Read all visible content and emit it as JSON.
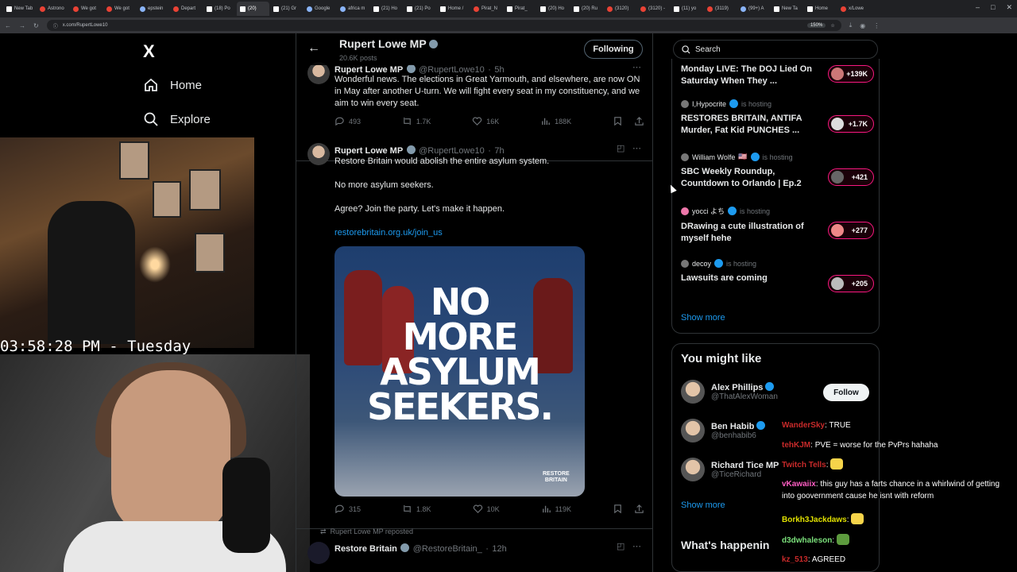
{
  "browser": {
    "tabs": [
      {
        "label": "New Tab",
        "fav": "x"
      },
      {
        "label": "Astrono",
        "fav": "r"
      },
      {
        "label": "We got",
        "fav": "r"
      },
      {
        "label": "We got",
        "fav": "r"
      },
      {
        "label": "epstein",
        "fav": "g"
      },
      {
        "label": "Depart",
        "fav": "r"
      },
      {
        "label": "(18) Po",
        "fav": "x"
      },
      {
        "label": "(20)",
        "fav": "x",
        "active": true
      },
      {
        "label": "(21) Gr",
        "fav": "x"
      },
      {
        "label": "Google",
        "fav": "g"
      },
      {
        "label": "africa m",
        "fav": "g"
      },
      {
        "label": "(21) Ho",
        "fav": "x"
      },
      {
        "label": "(21) Po",
        "fav": "x"
      },
      {
        "label": "Home /",
        "fav": "x"
      },
      {
        "label": "Pirat_N",
        "fav": "r"
      },
      {
        "label": "Pirat_",
        "fav": "x"
      },
      {
        "label": "(20) Ho",
        "fav": "x"
      },
      {
        "label": "(20) Ru",
        "fav": "x"
      },
      {
        "label": "(3120)",
        "fav": "r"
      },
      {
        "label": "(3120) -",
        "fav": "r"
      },
      {
        "label": "(11) yo",
        "fav": "x"
      },
      {
        "label": "(3119)",
        "fav": "r"
      },
      {
        "label": "(99+) A",
        "fav": "g"
      },
      {
        "label": "New Ta",
        "fav": "x"
      },
      {
        "label": "Home",
        "fav": "x"
      },
      {
        "label": "x/Lowe",
        "fav": "r"
      }
    ],
    "url": "x.com/RupertLowe10",
    "zoom": "150%"
  },
  "nav": {
    "logo": "X",
    "home": "Home",
    "explore": "Explore"
  },
  "stream": {
    "clock": "03:58:28 PM - Tuesday"
  },
  "profile": {
    "name": "Rupert Lowe MP",
    "posts": "20.6K posts",
    "follow_label": "Following"
  },
  "tweets": [
    {
      "name": "Rupert Lowe MP",
      "handle": "@RupertLowe10",
      "time": "5h",
      "text": "Wonderful news. The elections in Great Yarmouth, and elsewhere, are now ON in May after another U-turn. We will fight every seat in my constituency, and we aim to win every seat.",
      "replies": "493",
      "reposts": "1.7K",
      "likes": "16K",
      "views": "188K"
    },
    {
      "name": "Rupert Lowe MP",
      "handle": "@RupertLowe10",
      "time": "7h",
      "line1": "Restore Britain would abolish the entire asylum system.",
      "line2": "No more asylum seekers.",
      "line3": "Agree? Join the party. Let's make it happen.",
      "link": "restorebritain.org.uk/join_us",
      "media_lines": [
        "NO",
        "MORE",
        "ASYLUM",
        "SEEKERS."
      ],
      "media_logo": [
        "RESTORE",
        "BRITAIN"
      ],
      "replies": "315",
      "reposts": "1.8K",
      "likes": "10K",
      "views": "119K"
    },
    {
      "repost_label": "Rupert Lowe MP reposted",
      "name": "Restore Britain",
      "handle": "@RestoreBritain_",
      "time": "12h"
    }
  ],
  "search": {
    "placeholder": "Search"
  },
  "spaces": {
    "items": [
      {
        "host": "",
        "title": "Monday LIVE: The DOJ Lied On Saturday When They ...",
        "count": "+139K"
      },
      {
        "host": "I,Hypocrite",
        "title": "RESTORES BRITAIN, ANTIFA Murder, Fat Kid PUNCHES ...",
        "count": "+1.7K"
      },
      {
        "host": "William Wolfe",
        "title": "SBC Weekly Roundup, Countdown to Orlando | Ep.2",
        "count": "+421"
      },
      {
        "host": "yocci よち",
        "title": "DRawing a cute illustration of myself hehe",
        "count": "+277"
      },
      {
        "host": "decoy",
        "title": "Lawsuits are coming",
        "count": "+205"
      }
    ],
    "is_hosting": "is hosting",
    "show_more": "Show more"
  },
  "you_might_like": {
    "title": "You might like",
    "people": [
      {
        "name": "Alex Phillips",
        "handle": "@ThatAlexWoman",
        "action": "Follow"
      },
      {
        "name": "Ben Habib",
        "handle": "@benhabib6"
      },
      {
        "name": "Richard Tice MP",
        "handle": "@TiceRichard"
      }
    ],
    "show_more": "Show more"
  },
  "whats_happening": "What's happenin",
  "chat": [
    {
      "user": "WanderSky",
      "text": "TRUE",
      "color": "#c92a2a"
    },
    {
      "user": "tehKJM",
      "text": "PVE = worse for the PvPrs hahaha",
      "color": "#c92a2a"
    },
    {
      "user": "Twitch Tells",
      "text": "",
      "color": "#c92a2a"
    },
    {
      "user": "vKawaiix",
      "text": "this guy has a farts chance in a whirlwind of getting into goovernment cause he isnt with reform",
      "color": "#ff5ec4"
    },
    {
      "user": "Borkh3Jackdaws",
      "text": "",
      "color": "#e0e000"
    },
    {
      "user": "d3dwhaleson",
      "text": "",
      "color": "#7be07b"
    },
    {
      "user": "kz_513",
      "text": "AGREED",
      "color": "#c92a2a"
    }
  ],
  "colors": {
    "accent": "#1d9bf0",
    "live": "#f91880",
    "bg": "#000000"
  }
}
